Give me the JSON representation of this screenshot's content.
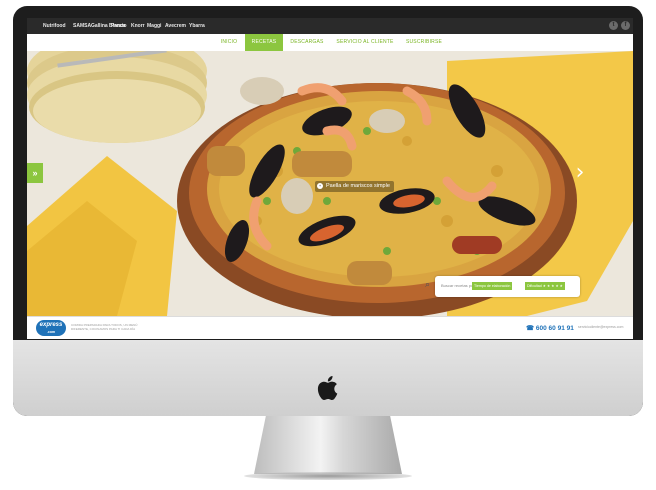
{
  "brands": [
    "Nutrifood",
    "SAMSA",
    "Gallina Blanca",
    "Presto",
    "Knorr",
    "Maggi",
    "Avecrem",
    "Ybarra"
  ],
  "social": {
    "twitter_icon": "twitter-icon",
    "facebook_icon": "facebook-icon"
  },
  "nav": {
    "items": [
      "INICIO",
      "RECETAS",
      "DESCARGAS",
      "SERVICIO AL CLIENTE",
      "SUSCRIBIRSE"
    ],
    "active_index": 1
  },
  "hero": {
    "left_arrow": "»",
    "right_arrow": "›",
    "caption": "Paella de mariscos simple",
    "caption_icon": "+"
  },
  "search": {
    "label": "Buscar recetas por:",
    "chips": [
      "Tiempo de elaboración",
      "Dificultad ★ ★ ★ ★ ★"
    ]
  },
  "footer": {
    "logo_text": "express",
    "logo_sub": ".com",
    "text": "COMIDA PREPARADA PARA TODOS, UN MENÚ DIFERENTE, COCINAMOS PARA TI CADA DÍA",
    "phone": "600 60 91 91",
    "email": "serviciocliente@express.com"
  },
  "colors": {
    "accent": "#8cc63f",
    "brand_blue": "#1f72b8",
    "topbar": "#2a2a2a"
  }
}
